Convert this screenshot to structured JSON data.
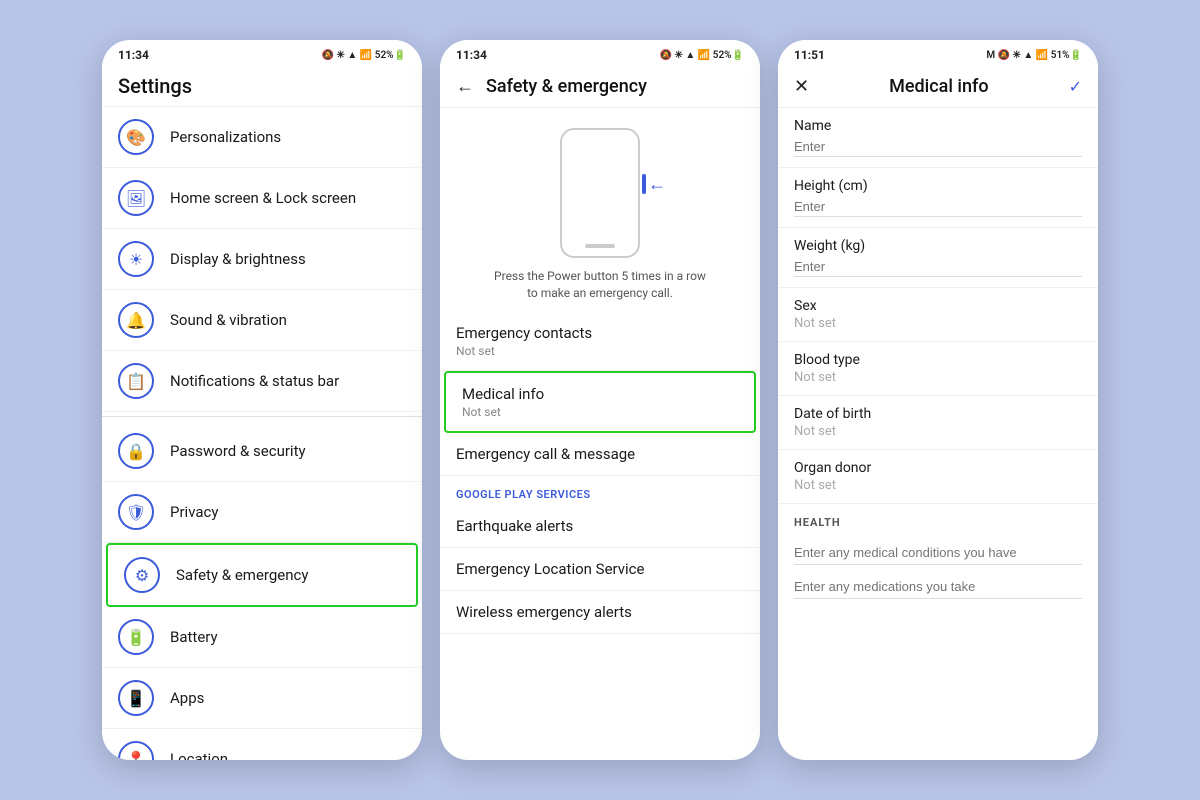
{
  "panel1": {
    "status": {
      "time": "11:34",
      "icons": "🔕 ✳ ▲ 📶 52%🔋"
    },
    "header": "Settings",
    "items": [
      {
        "icon": "🎨",
        "label": "Personalizations"
      },
      {
        "icon": "🖼",
        "label": "Home screen & Lock screen"
      },
      {
        "icon": "☀",
        "label": "Display & brightness"
      },
      {
        "icon": "🔔",
        "label": "Sound & vibration"
      },
      {
        "icon": "📋",
        "label": "Notifications & status bar"
      },
      {
        "icon": "🔒",
        "label": "Password & security",
        "divider_before": true
      },
      {
        "icon": "🛡",
        "label": "Privacy"
      },
      {
        "icon": "⚙",
        "label": "Safety & emergency",
        "highlighted": true
      },
      {
        "icon": "🔋",
        "label": "Battery"
      },
      {
        "icon": "📱",
        "label": "Apps"
      },
      {
        "icon": "📍",
        "label": "Location"
      }
    ]
  },
  "panel2": {
    "status": {
      "time": "11:34",
      "icons": "🔕 ✳ ▲ 📶 52%🔋"
    },
    "title": "Safety & emergency",
    "sos_caption": "Press the Power button 5 times in a row to make an emergency call.",
    "items": [
      {
        "title": "Emergency contacts",
        "sub": "Not set"
      },
      {
        "title": "Medical info",
        "sub": "Not set",
        "highlighted": true
      },
      {
        "title": "Emergency call & message",
        "sub": ""
      }
    ],
    "section_label": "GOOGLE PLAY SERVICES",
    "google_items": [
      {
        "title": "Earthquake alerts",
        "sub": ""
      },
      {
        "title": "Emergency Location Service",
        "sub": ""
      },
      {
        "title": "Wireless emergency alerts",
        "sub": ""
      }
    ]
  },
  "panel3": {
    "status": {
      "time": "11:51",
      "icons": "M 🔕 ✳ ▲ 📶 51%🔋"
    },
    "title": "Medical info",
    "fields": [
      {
        "label": "Name",
        "value": "Enter"
      },
      {
        "label": "Height (cm)",
        "value": "Enter"
      },
      {
        "label": "Weight (kg)",
        "value": "Enter"
      },
      {
        "label": "Sex",
        "value": "Not set"
      },
      {
        "label": "Blood type",
        "value": "Not set"
      },
      {
        "label": "Date of birth",
        "value": "Not set"
      },
      {
        "label": "Organ donor",
        "value": "Not set"
      }
    ],
    "health_section": "HEALTH",
    "health_inputs": [
      "Enter any medical conditions you have",
      "Enter any medications you take"
    ]
  }
}
